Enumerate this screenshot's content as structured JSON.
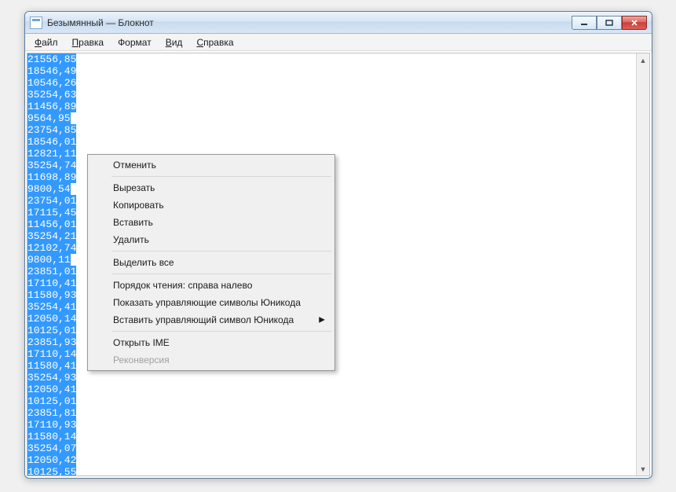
{
  "window": {
    "title": "Безымянный — Блокнот"
  },
  "menubar": {
    "file": "Файл",
    "edit": "Правка",
    "format": "Формат",
    "view": "Вид",
    "help": "Справка"
  },
  "text_lines": [
    "21556,85",
    "18546,49",
    "10546,26",
    "35254,63",
    "11456,89",
    "9564,95",
    "23754,85",
    "18546,01",
    "12821,11",
    "35254,74",
    "11698,89",
    "9800,54",
    "23754,01",
    "17115,45",
    "11456,01",
    "35254,21",
    "12102,74",
    "9800,11",
    "23851,01",
    "17110,41",
    "11580,93",
    "35254,41",
    "12050,14",
    "10125,01",
    "23851,93",
    "17110,14",
    "11580,41",
    "35254,93",
    "12050,41",
    "10125,01",
    "23851,81",
    "17110,93",
    "11580,14",
    "35254,07",
    "12050,42",
    "10125,55"
  ],
  "context_menu": {
    "undo": "Отменить",
    "cut": "Вырезать",
    "copy": "Копировать",
    "paste": "Вставить",
    "delete": "Удалить",
    "select_all": "Выделить все",
    "reading_order": "Порядок чтения: справа налево",
    "show_unicode": "Показать управляющие символы Юникода",
    "insert_unicode": "Вставить управляющий символ Юникода",
    "open_ime": "Открыть IME",
    "reconversion": "Реконверсия"
  }
}
